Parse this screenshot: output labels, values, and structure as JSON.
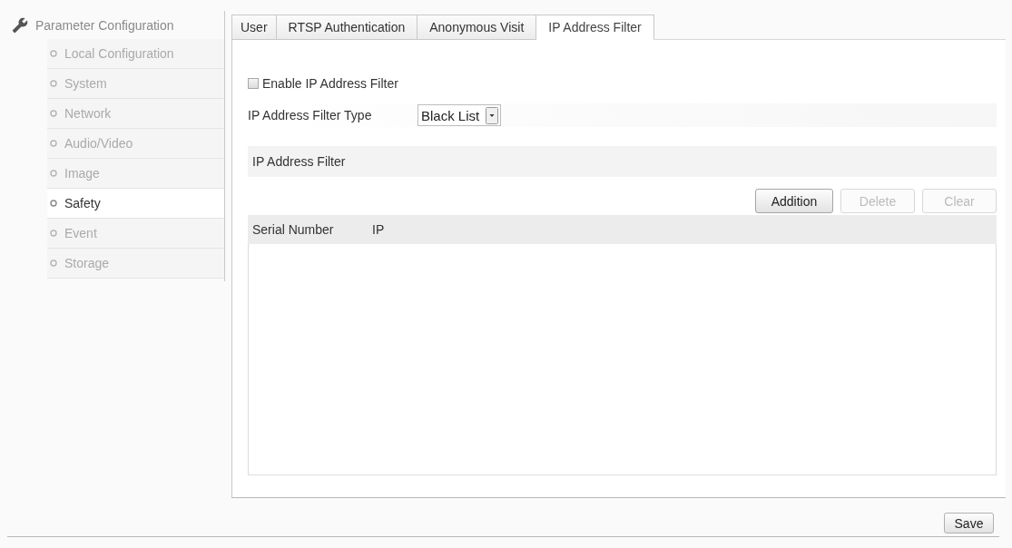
{
  "sidebar": {
    "title": "Parameter Configuration",
    "items": [
      {
        "label": "Local Configuration",
        "selected": false
      },
      {
        "label": "System",
        "selected": false
      },
      {
        "label": "Network",
        "selected": false
      },
      {
        "label": "Audio/Video",
        "selected": false
      },
      {
        "label": "Image",
        "selected": false
      },
      {
        "label": "Safety",
        "selected": true
      },
      {
        "label": "Event",
        "selected": false
      },
      {
        "label": "Storage",
        "selected": false
      }
    ]
  },
  "tabs": [
    {
      "label": "User",
      "selected": false
    },
    {
      "label": "RTSP Authentication",
      "selected": false
    },
    {
      "label": "Anonymous Visit",
      "selected": false
    },
    {
      "label": "IP Address Filter",
      "selected": true
    }
  ],
  "filter": {
    "enable": {
      "label": "Enable IP Address Filter",
      "checked": false
    },
    "type": {
      "label": "IP Address Filter Type",
      "value": "Black List"
    }
  },
  "list": {
    "title": "IP Address Filter",
    "buttons": [
      {
        "label": "Addition",
        "disabled": false
      },
      {
        "label": "Delete",
        "disabled": true
      },
      {
        "label": "Clear",
        "disabled": true
      }
    ],
    "table": {
      "columns": [
        "Serial Number",
        "IP"
      ]
    }
  },
  "save_button": {
    "label": "Save"
  }
}
